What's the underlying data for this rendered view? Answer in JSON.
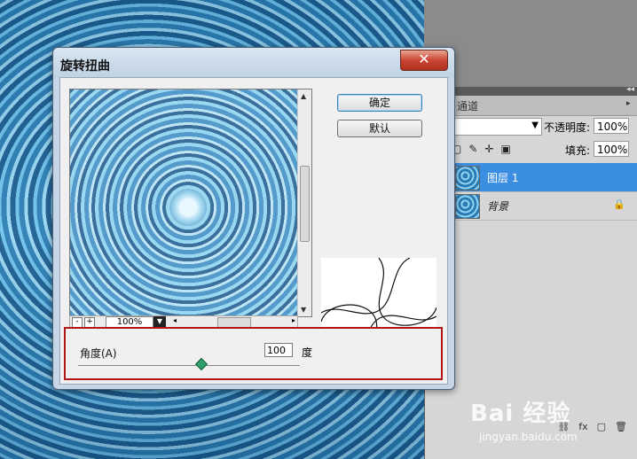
{
  "dialog": {
    "title": "旋转扭曲",
    "close_label": "✕",
    "ok_label": "确定",
    "default_label": "默认",
    "zoom": {
      "minus": "-",
      "plus": "+",
      "value": "100%"
    },
    "angle": {
      "label": "角度(A)",
      "value": "100",
      "unit": "度",
      "slider_fraction": 0.55
    }
  },
  "layers_panel": {
    "tab_label": "通道",
    "opacity_label": "不透明度:",
    "opacity_value": "100%",
    "fill_label": "填充:",
    "fill_value": "100%",
    "layers": [
      {
        "name": "图层 1",
        "selected": true
      },
      {
        "name": "背景",
        "locked": true
      }
    ]
  },
  "watermark": {
    "brand": "Bai 经验",
    "url": "jingyan.baidu.com"
  },
  "colors": {
    "selection": "#3b8ee2",
    "highlight_border": "#b01414",
    "close": "#c94533"
  }
}
